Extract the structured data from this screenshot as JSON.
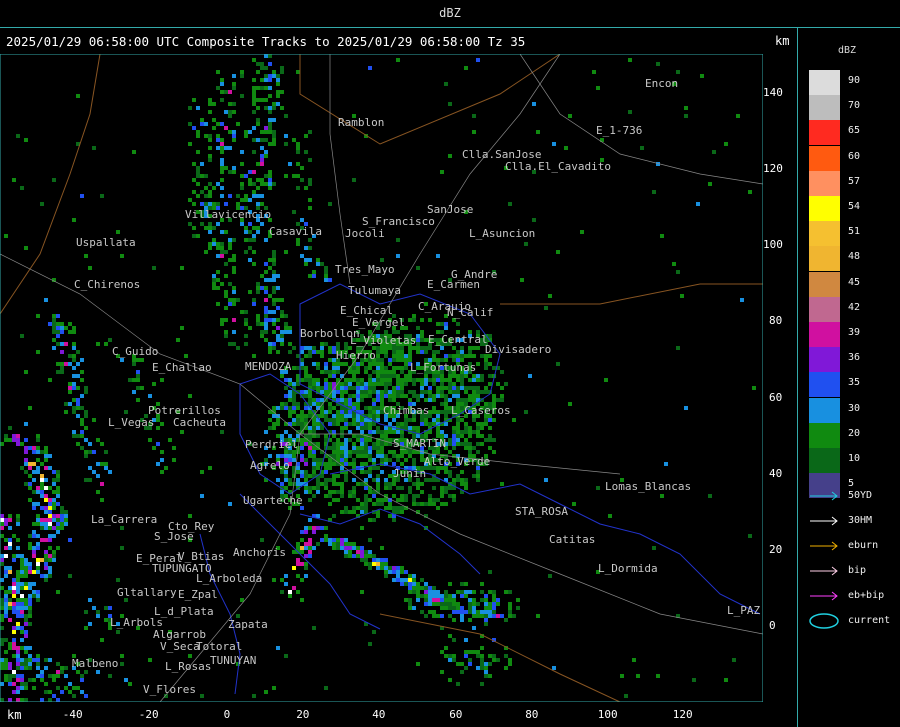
{
  "window": {
    "title": "dBZ"
  },
  "header": {
    "title": "2025/01/29 06:58:00 UTC Composite Tracks to 2025/01/29 06:58:00 Tz 35",
    "km_top": "km",
    "km_bottom": "km"
  },
  "axes": {
    "y": {
      "unit": "km",
      "ticks": [
        "140",
        "120",
        "100",
        "80",
        "60",
        "40",
        "20",
        "0"
      ]
    },
    "x": {
      "unit": "km",
      "ticks": [
        "-40",
        "-20",
        "0",
        "20",
        "40",
        "60",
        "80",
        "100",
        "120"
      ]
    }
  },
  "legend": {
    "title": "dBZ",
    "swatches": [
      {
        "label": "90",
        "color": "#dcdcdc"
      },
      {
        "label": "70",
        "color": "#bdbdbd"
      },
      {
        "label": "65",
        "color": "#ff2a20"
      },
      {
        "label": "60",
        "color": "#ff5a10"
      },
      {
        "label": "57",
        "color": "#ff9060"
      },
      {
        "label": "54",
        "color": "#ffff00"
      },
      {
        "label": "51",
        "color": "#f5c030"
      },
      {
        "label": "48",
        "color": "#f0b530"
      },
      {
        "label": "45",
        "color": "#d08840"
      },
      {
        "label": "42",
        "color": "#c06890"
      },
      {
        "label": "39",
        "color": "#d010a0"
      },
      {
        "label": "36",
        "color": "#8018d8"
      },
      {
        "label": "35",
        "color": "#2050f0"
      },
      {
        "label": "30",
        "color": "#1890e0"
      },
      {
        "label": "20",
        "color": "#108a10"
      },
      {
        "label": "10",
        "color": "#0a6818"
      },
      {
        "label": "5",
        "color": "#45408a"
      }
    ],
    "tracks": [
      {
        "label": "50YD",
        "color": "#20d0e0"
      },
      {
        "label": "30HM",
        "color": "#ffffff"
      },
      {
        "label": "eburn",
        "color": "#f0b000"
      },
      {
        "label": "bip",
        "color": "#ffd0e8"
      },
      {
        "label": "eb+bip",
        "color": "#ff40ff"
      }
    ],
    "current": {
      "label": "current",
      "color": "#20d0e0"
    }
  },
  "places": [
    {
      "name": "Ramblon"
    },
    {
      "name": "Encon"
    },
    {
      "name": "E_1-736"
    },
    {
      "name": "Clla.SanJose"
    },
    {
      "name": "Clla.El_Cavadito"
    },
    {
      "name": "Villavicencio"
    },
    {
      "name": "S_Francisco"
    },
    {
      "name": "SanJose"
    },
    {
      "name": "Uspallata"
    },
    {
      "name": "Casavila"
    },
    {
      "name": "Jocoli"
    },
    {
      "name": "L_Asuncion"
    },
    {
      "name": "Tres_Mayo"
    },
    {
      "name": "G_Andre"
    },
    {
      "name": "C_Chirenos"
    },
    {
      "name": "Tulumaya"
    },
    {
      "name": "E_Carmen"
    },
    {
      "name": "C_Araujo"
    },
    {
      "name": "E_Chical"
    },
    {
      "name": "E_Vergel"
    },
    {
      "name": "N_Calif"
    },
    {
      "name": "Borbollon"
    },
    {
      "name": "E_Central"
    },
    {
      "name": "Divisadero"
    },
    {
      "name": "C_Guido"
    },
    {
      "name": "L_Violetas"
    },
    {
      "name": "Hierro"
    },
    {
      "name": "E_Challao"
    },
    {
      "name": "L_Fortunas"
    },
    {
      "name": "MENDOZA"
    },
    {
      "name": "Potrerillos"
    },
    {
      "name": "Cacheuta"
    },
    {
      "name": "L_Vegas"
    },
    {
      "name": "Chimbas"
    },
    {
      "name": "L_Caseros"
    },
    {
      "name": "S_MARTIN"
    },
    {
      "name": "Perdriel"
    },
    {
      "name": "Agrelo"
    },
    {
      "name": "Junin"
    },
    {
      "name": "Alto_Verde"
    },
    {
      "name": "Ugarteche"
    },
    {
      "name": "Lomas_Blancas"
    },
    {
      "name": "La_Carrera"
    },
    {
      "name": "Cto_Rey"
    },
    {
      "name": "S_Jose"
    },
    {
      "name": "STA_ROSA"
    },
    {
      "name": "Catitas"
    },
    {
      "name": "E_Peral"
    },
    {
      "name": "V_Btias"
    },
    {
      "name": "Anchoris"
    },
    {
      "name": "TUPUNGATO"
    },
    {
      "name": "L_Dormida"
    },
    {
      "name": "L_Arboleda"
    },
    {
      "name": "Gltallary"
    },
    {
      "name": "E_Zpal"
    },
    {
      "name": "L_d_Plata"
    },
    {
      "name": "L_PAZ"
    },
    {
      "name": "L_Arbols"
    },
    {
      "name": "Zapata"
    },
    {
      "name": "Algarrob"
    },
    {
      "name": "TUNUYAN"
    },
    {
      "name": "V_Seca"
    },
    {
      "name": "Malbeno"
    },
    {
      "name": "L_Rosas"
    },
    {
      "name": "V_Flores"
    },
    {
      "name": "Totoral"
    }
  ]
}
